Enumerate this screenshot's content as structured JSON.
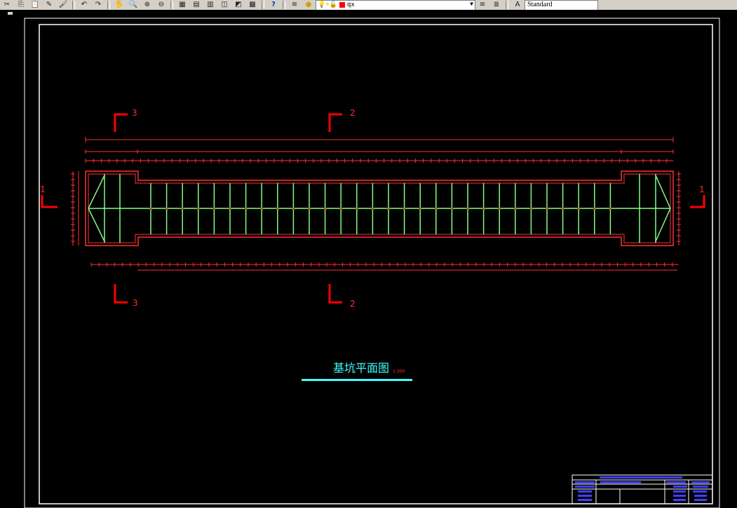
{
  "toolbar": {
    "icons": [
      "cut-icon",
      "copy-icon",
      "paste-icon",
      "match-properties-icon",
      "undo-icon",
      "redo-icon",
      "pan-icon",
      "zoom-realtime-icon",
      "zoom-window-icon",
      "zoom-previous-icon",
      "properties-icon",
      "design-center-icon",
      "tool-palettes-icon",
      "sheet-set-icon",
      "markup-icon",
      "calculator-icon",
      "help-icon",
      "layer-manager-icon"
    ],
    "layer_name": "qx",
    "layer_color": "#ff0000",
    "text_style": "Standard"
  },
  "drawing": {
    "title": "基坑平面图",
    "scale_label": "1:300",
    "sections": [
      {
        "id": "top-left",
        "label": "3"
      },
      {
        "id": "top-mid",
        "label": "2"
      },
      {
        "id": "left",
        "label": "1"
      },
      {
        "id": "right",
        "label": "1"
      },
      {
        "id": "bottom-left",
        "label": "3"
      },
      {
        "id": "bottom-mid",
        "label": "2"
      }
    ],
    "colors": {
      "section_marks": "#ff0000",
      "walls": "#ff3030",
      "struts": "#80ff80",
      "title": "#40ffff",
      "frame": "#ffffff",
      "titleblock_text": "#4040ff"
    }
  }
}
